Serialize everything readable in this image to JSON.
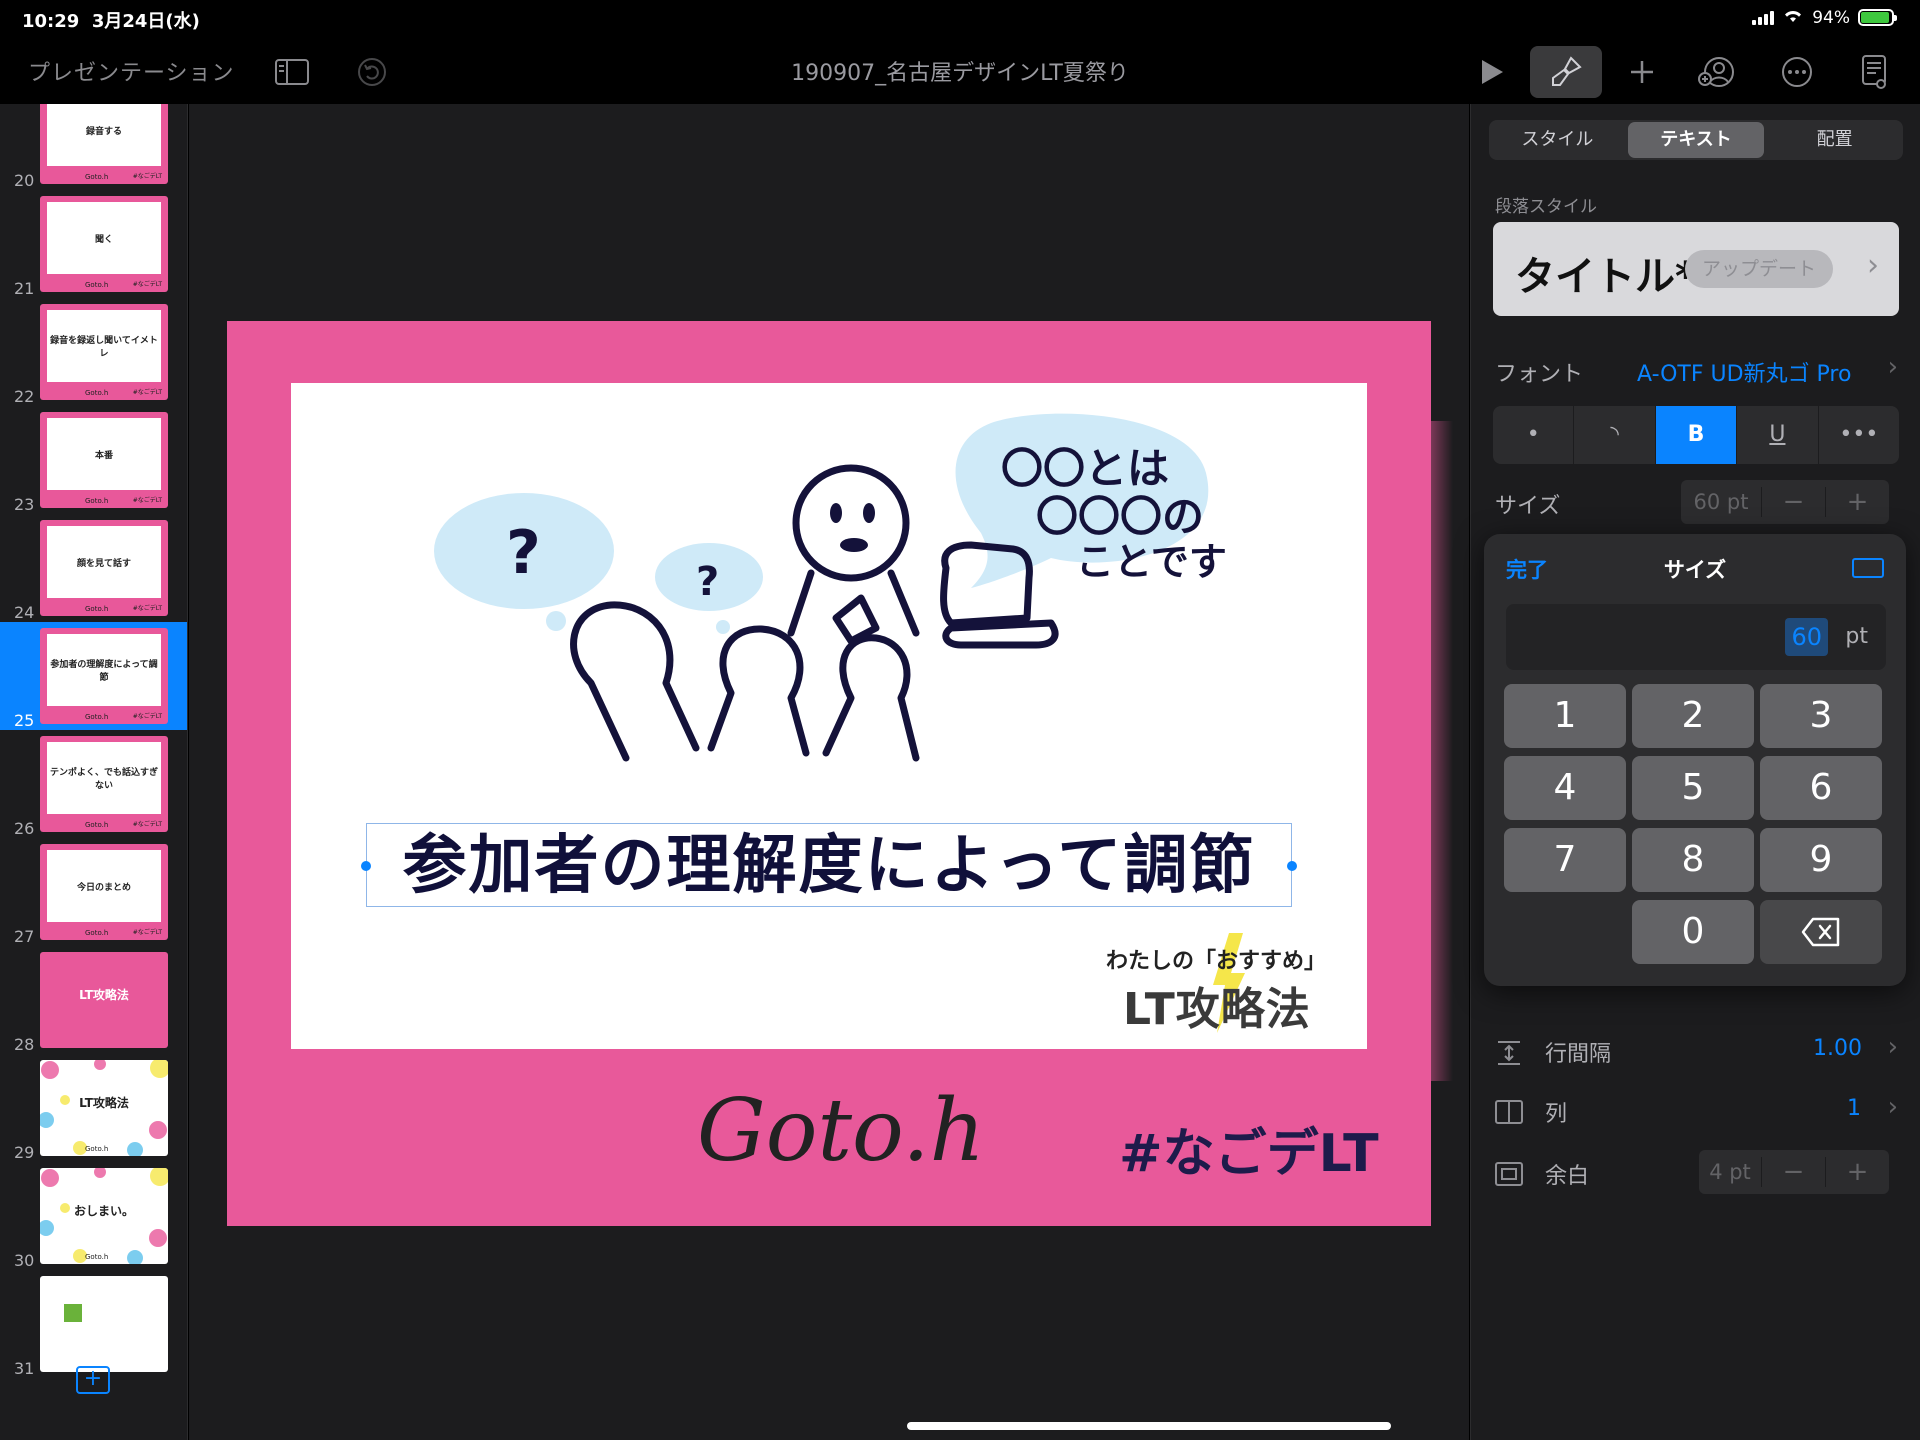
{
  "status": {
    "time": "10:29",
    "date": "3月24日(水)",
    "battery": "94%",
    "battery_level": 0.94
  },
  "toolbar": {
    "present_label": "プレゼンテーション",
    "doc_title": "190907_名古屋デザインLT夏祭り"
  },
  "navigator": {
    "slides": [
      {
        "num": "20",
        "text": "録音する"
      },
      {
        "num": "21",
        "text": "聞く"
      },
      {
        "num": "22",
        "text": "録音を録返し聞いてイメトレ"
      },
      {
        "num": "23",
        "text": "本番"
      },
      {
        "num": "24",
        "text": "顔を見て話す"
      },
      {
        "num": "25",
        "text": "参加者の理解度によって調節"
      },
      {
        "num": "26",
        "text": "テンポよく、でも話込すぎない"
      },
      {
        "num": "27",
        "text": "今日のまとめ"
      },
      {
        "num": "28",
        "text": "LT攻略法"
      },
      {
        "num": "29",
        "text": "LT攻略法"
      },
      {
        "num": "30",
        "text": "おしまい。"
      },
      {
        "num": "31",
        "text": ""
      }
    ],
    "selected": "25",
    "thumb_brand": "Goto.h",
    "thumb_tag": "#なごデLT",
    "add_label": "+"
  },
  "slide": {
    "title": "参加者の理解度によって調節",
    "speech": "〇〇とは 〇〇〇の ことです",
    "question": "?",
    "sub_small": "わたしの「おすすめ」",
    "sub_big": "LT攻略法",
    "brand": "Goto.h",
    "hashtag": "#なごデLT"
  },
  "inspector": {
    "tabs": [
      "スタイル",
      "テキスト",
      "配置"
    ],
    "selected_tab": "テキスト",
    "para_style_label": "段落スタイル",
    "para_style_name": "タイトル*",
    "update_label": "アップデート",
    "font_label": "フォント",
    "font_value": "A-OTF UD新丸ゴ Pro",
    "format_buttons": [
      "•",
      "◝",
      "B",
      "U",
      "•••"
    ],
    "size_label": "サイズ",
    "size_value": "60 pt",
    "line_spacing_label": "行間隔",
    "line_spacing_value": "1.00",
    "columns_label": "列",
    "columns_value": "1",
    "margin_label": "余白",
    "margin_value": "4 pt",
    "minus": "−",
    "plus": "+"
  },
  "keypad": {
    "done": "完了",
    "title": "サイズ",
    "value": "60",
    "unit": "pt",
    "keys": [
      "1",
      "2",
      "3",
      "4",
      "5",
      "6",
      "7",
      "8",
      "9",
      "0"
    ],
    "delete": "⌫"
  }
}
